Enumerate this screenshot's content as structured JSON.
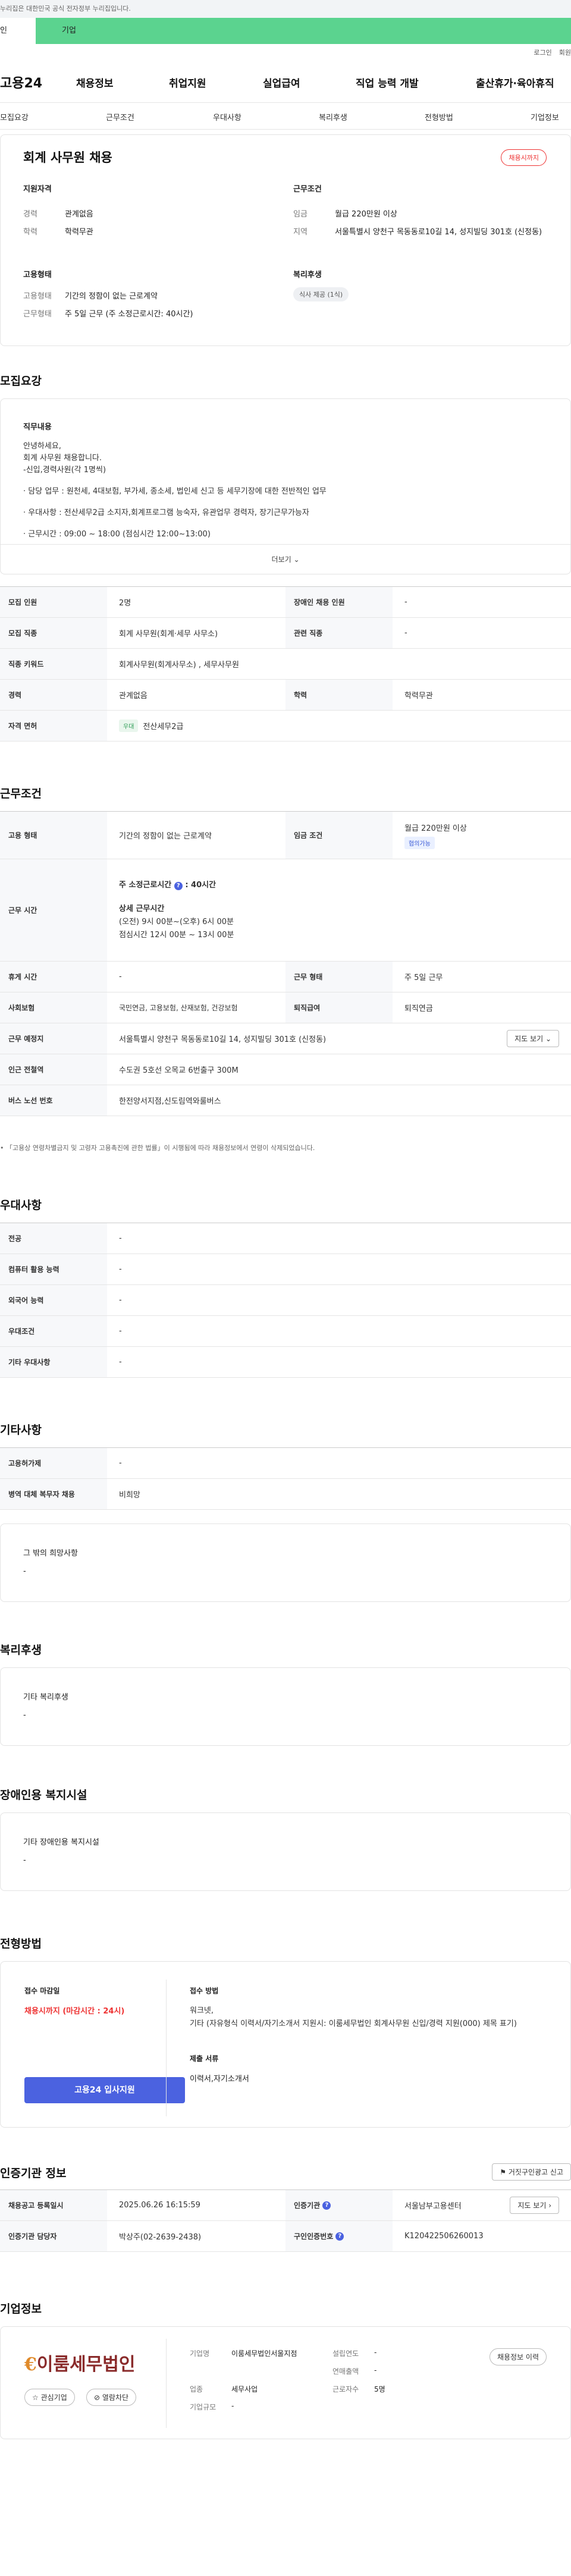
{
  "gov_banner": "누리집은 대한민국 공식 전자정부 누리집입니다.",
  "tabs": [
    "인",
    "기업"
  ],
  "util": [
    "로그인",
    "회원"
  ],
  "logo": "고용24",
  "gnb": [
    "채용정보",
    "취업지원",
    "실업급여",
    "직업 능력 개발",
    "출산휴가·육아휴직"
  ],
  "subnav": [
    "모집요강",
    "근무조건",
    "우대사항",
    "복리후생",
    "전형방법",
    "기업정보"
  ],
  "job": {
    "title": "회계 사무원 채용",
    "badge": "채용시까지",
    "qual_h": "지원자격",
    "career_k": "경력",
    "career_v": "관계없음",
    "edu_k": "학력",
    "edu_v": "학력무관",
    "cond_h": "근무조건",
    "wage_k": "임금",
    "wage_v": "월급 220만원 이상",
    "loc_k": "지역",
    "loc_v": "서울특별시 양천구 목동동로10길 14, 성지빌딩 301호 (신정동)",
    "emp_h": "고용형태",
    "etype_k": "고용형태",
    "etype_v": "기간의 정함이 없는 근로계약",
    "wtime_k": "근무형태",
    "wtime_v": "주 5일 근무 (주 소정근로시간: 40시간)",
    "welfare_h": "복리후생",
    "welfare_pill": "식사 제공 (1식)"
  },
  "recruit": {
    "h": "모집요강",
    "duty_h": "직무내용",
    "lines": [
      "안녕하세요,",
      "회계 사무원 채용합니다.",
      "-신입,경력사원(각 1명씩)",
      "· 담당 업무 : 원천세, 4대보험, 부가세, 종소세, 법인세 신고 등 세무기장에 대한 전반적인 업무",
      "· 우대사항 : 전산세무2급 소지자,회계프로그램 능숙자, 유관업무 경력자, 장기근무가능자",
      "· 근무시간 : 09:00 ~ 18:00 (점심시간 12:00~13:00)"
    ],
    "more": "더보기",
    "r1": [
      "모집 인원",
      "2명",
      "장애인 채용 인원",
      "-"
    ],
    "r2": [
      "모집 직종",
      "회계 사무원(회계·세무 사무소)",
      "관련 직종",
      "-"
    ],
    "r3": [
      "직종 키워드",
      "회계사무원(회계사무소) , 세무사무원"
    ],
    "r4": [
      "경력",
      "관계없음",
      "학력",
      "학력무관"
    ],
    "r5": [
      "자격 면허",
      "우대",
      "전산세무2급"
    ]
  },
  "cond": {
    "h": "근무조건",
    "type": [
      "고용 형태",
      "기간의 정함이 없는 근로계약",
      "임금 조건",
      "월급 220만원 이상",
      "협의가능"
    ],
    "time_k": "근무 시간",
    "time_main": "주 소정근로시간",
    "time_hours": ": 40시간",
    "time_detail_h": "상세 근무시간",
    "time_l1": "(오전) 9시 00분~(오후) 6시 00분",
    "time_l2": "점심시간 12시 00분 ~ 13시 00분",
    "rest": [
      "휴게 시간",
      "-",
      "근무 형태",
      "주 5일 근무"
    ],
    "ins": [
      "사회보험",
      "국민연금, 고용보험, 산재보험, 건강보험",
      "퇴직급여",
      "퇴직연금"
    ],
    "place": [
      "근무 예정지",
      "서울특별시 양천구 목동동로10길 14, 성지빌딩 301호 (신정동)",
      "지도 보기"
    ],
    "subway": [
      "인근 전철역",
      "수도권 5호선 오목교 6번출구 300M"
    ],
    "bus": [
      "버스 노선 번호",
      "한전양서지점,신도림역와룰버스"
    ],
    "note": "「고용상 연령차별금지 및 고령자 고용촉진에 관한 법률」이 시행됨에 따라 채용정보에서 연령이 삭제되었습니다."
  },
  "pref": {
    "h": "우대사항",
    "rows": [
      [
        "전공",
        "-"
      ],
      [
        "컴퓨터 활용 능력",
        "-"
      ],
      [
        "외국어 능력",
        "-"
      ],
      [
        "우대조건",
        "-"
      ],
      [
        "기타 우대사항",
        "-"
      ]
    ]
  },
  "etc": {
    "h": "기타사항",
    "rows": [
      [
        "고용허가제",
        "-"
      ],
      [
        "병역 대체 복무자 채용",
        "비희망"
      ]
    ],
    "wish_h": "그 밖의 희망사항",
    "wish_v": "-"
  },
  "welfare": {
    "h": "복리후생",
    "sub_h": "기타 복리후생",
    "sub_v": "-"
  },
  "disabled": {
    "h": "장애인용 복지시설",
    "sub_h": "기타 장애인용 복지시설",
    "sub_v": "-"
  },
  "process": {
    "h": "전형방법",
    "deadline_h": "접수 마감일",
    "deadline_v": "채용시까지 (마감시간 : 24시)",
    "apply": "고용24 입사지원",
    "method_h": "접수 방법",
    "method_v1": "워크넷,",
    "method_v2": "기타 (자유형식 이력서/자기소개서 지원시: 이룸세무법인 회계사무원 신입/경력 지원(000) 제목 표기)",
    "docs_h": "제출 서류",
    "docs_v": "이력서,자기소개서"
  },
  "agency": {
    "h": "인증기관 정보",
    "btn": "거짓구인광고 신고",
    "reg": [
      "채용공고 등록일시",
      "2025.06.26 16:15:59",
      "인증기관",
      "서울남부고용센터",
      "지도 보기"
    ],
    "mgr": [
      "인증기관 담당자",
      "박상주(02-2639-2438)",
      "구인인증번호",
      "K120422506260013"
    ]
  },
  "company": {
    "h": "기업정보",
    "logo": "이룸세무법인",
    "fav": "관심기업",
    "block": "열람차단",
    "name_k": "기업명",
    "name_v": "이룸세무법인서울지점",
    "ind_k": "업종",
    "ind_v": "세무사업",
    "size_k": "기업규모",
    "size_v": "-",
    "est_k": "설립연도",
    "est_v": "-",
    "sales_k": "연매출액",
    "sales_v": "-",
    "emp_k": "근로자수",
    "emp_v": "5명",
    "info_btn": "채용정보 이력"
  },
  "colors": {
    "accent": "#5bd38f",
    "apply": "#4b62e0",
    "deadline": "#e33333"
  }
}
